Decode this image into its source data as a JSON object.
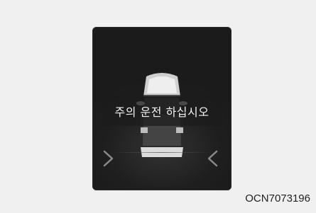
{
  "display": {
    "warning_message": "주의 운전 하십시오",
    "left_indicator_icon": "chevron-right",
    "right_indicator_icon": "chevron-left",
    "background_color": "#1b1b1b",
    "text_color": "#f2f2f2"
  },
  "figure": {
    "code": "OCN7073196"
  }
}
